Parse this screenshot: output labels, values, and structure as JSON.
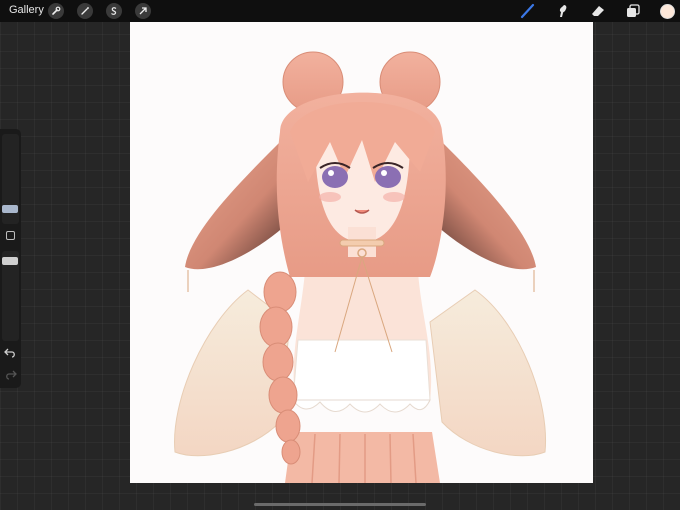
{
  "topbar": {
    "gallery_label": "Gallery",
    "left_tools": [
      {
        "icon": "wrench-icon",
        "name": "actions-tool"
      },
      {
        "icon": "magic-wand-icon",
        "name": "adjustments-tool"
      },
      {
        "icon": "selection-s-icon",
        "name": "selection-tool"
      },
      {
        "icon": "transform-arrow-icon",
        "name": "transform-tool"
      }
    ],
    "right_tools": [
      {
        "icon": "brush-icon",
        "name": "brush-tool",
        "active": true
      },
      {
        "icon": "smudge-icon",
        "name": "smudge-tool"
      },
      {
        "icon": "eraser-icon",
        "name": "eraser-tool"
      },
      {
        "icon": "layers-icon",
        "name": "layers-tool"
      }
    ],
    "color_swatch": "#fde8da",
    "active_color": "#3b78e7"
  },
  "sidebar": {
    "brush_size": 0.55,
    "opacity": 0.5,
    "buttons": [
      "modify-square-icon",
      "undo-icon",
      "redo-icon"
    ]
  },
  "canvas": {
    "background": "#fdfbfb",
    "artwork": "anime-girl-bunny-ears"
  }
}
